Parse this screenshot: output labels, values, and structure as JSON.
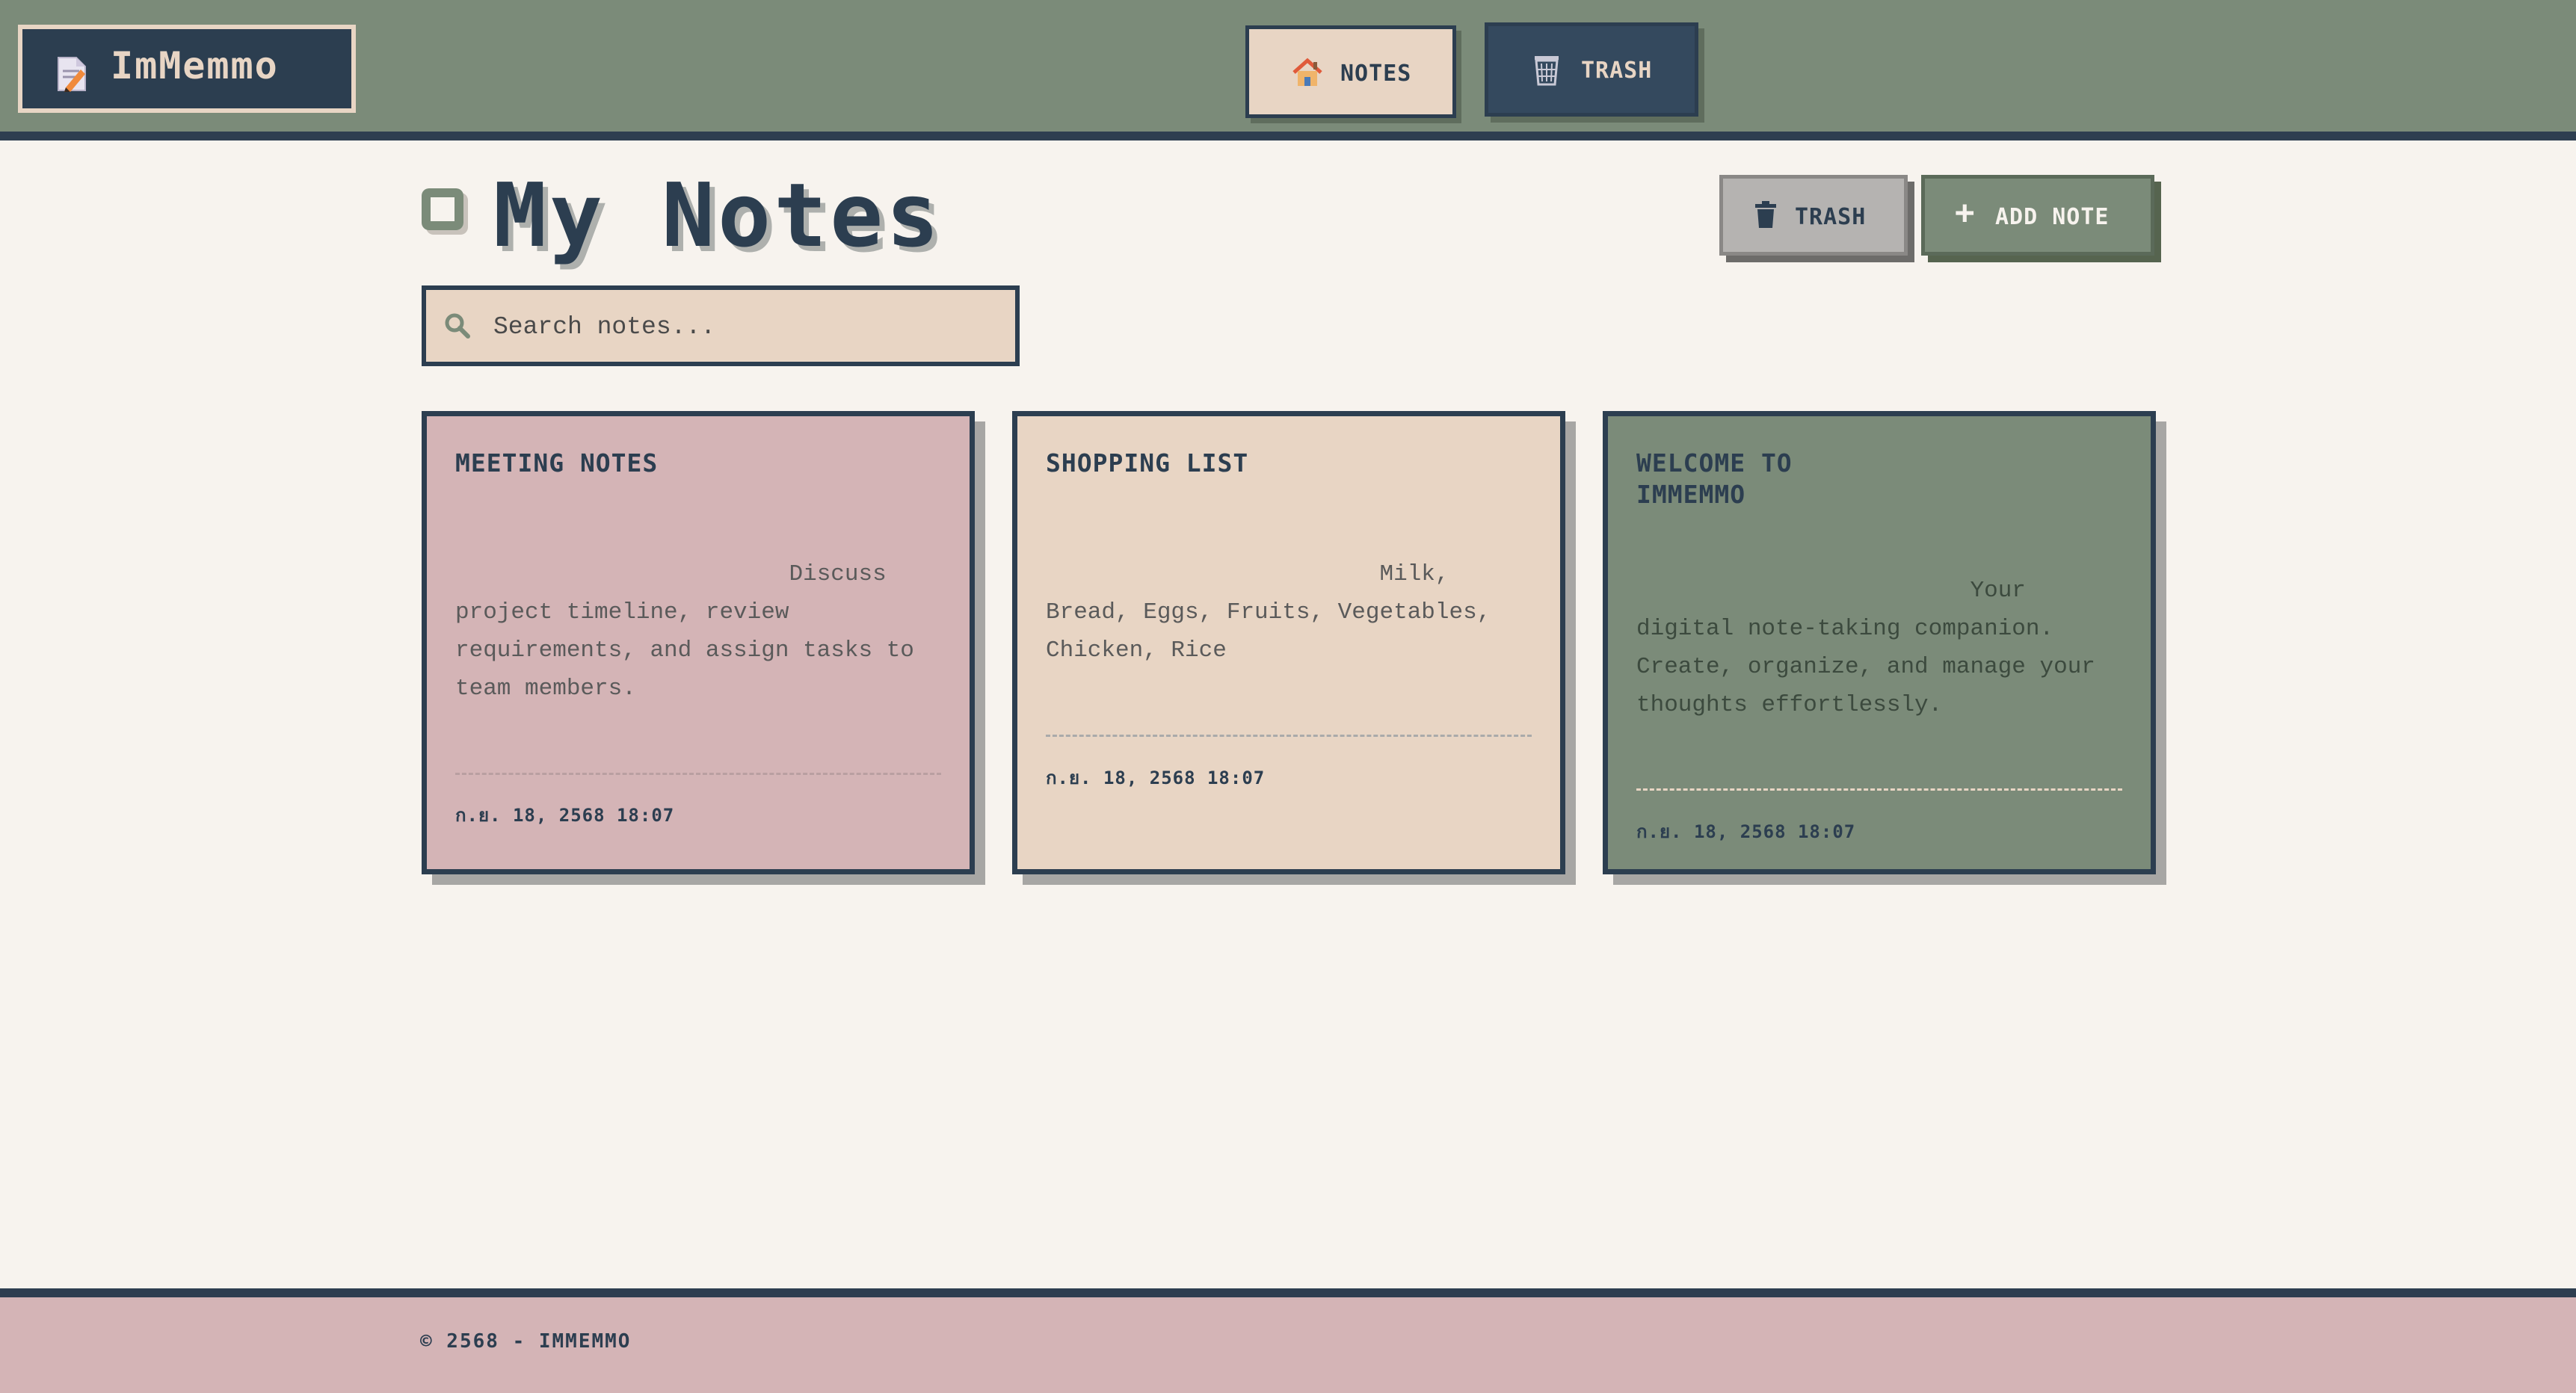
{
  "app": {
    "name": "ImMemmo",
    "logo_icon": "memo-icon"
  },
  "nav": {
    "notes_label": "NOTES",
    "notes_icon": "house-icon",
    "trash_label": "TRASH",
    "trash_icon": "wastebasket-icon",
    "active": "notes"
  },
  "main": {
    "title": "My Notes",
    "title_icon": "note-square-icon",
    "trash_button_label": "TRASH",
    "add_button_label": "ADD NOTE",
    "search": {
      "placeholder": "Search notes...",
      "value": ""
    },
    "notes": [
      {
        "title": "MEETING NOTES",
        "body": "                        Discuss\nproject timeline, review\nrequirements, and assign tasks to\nteam members.",
        "date": "ก.ย. 18, 2568 18:07",
        "color": "#d4b4b6"
      },
      {
        "title": "SHOPPING LIST",
        "body": "                        Milk,\nBread, Eggs, Fruits, Vegetables,\nChicken, Rice",
        "date": "ก.ย. 18, 2568 18:07",
        "color": "#e8d5c4"
      },
      {
        "title": "WELCOME TO\nIMMEMMO",
        "body": "                        Your\ndigital note-taking companion.\nCreate, organize, and manage your\nthoughts effortlessly.",
        "date": "ก.ย. 18, 2568 18:07",
        "color": "#7b8b79"
      }
    ]
  },
  "footer": {
    "text": "© 2568 - IMMEMMO"
  },
  "colors": {
    "header_bg": "#7b8b79",
    "dark": "#2c3e50",
    "cream": "#e8d5c4",
    "pink": "#d4b4b6",
    "page_bg": "#f7f3ee"
  }
}
